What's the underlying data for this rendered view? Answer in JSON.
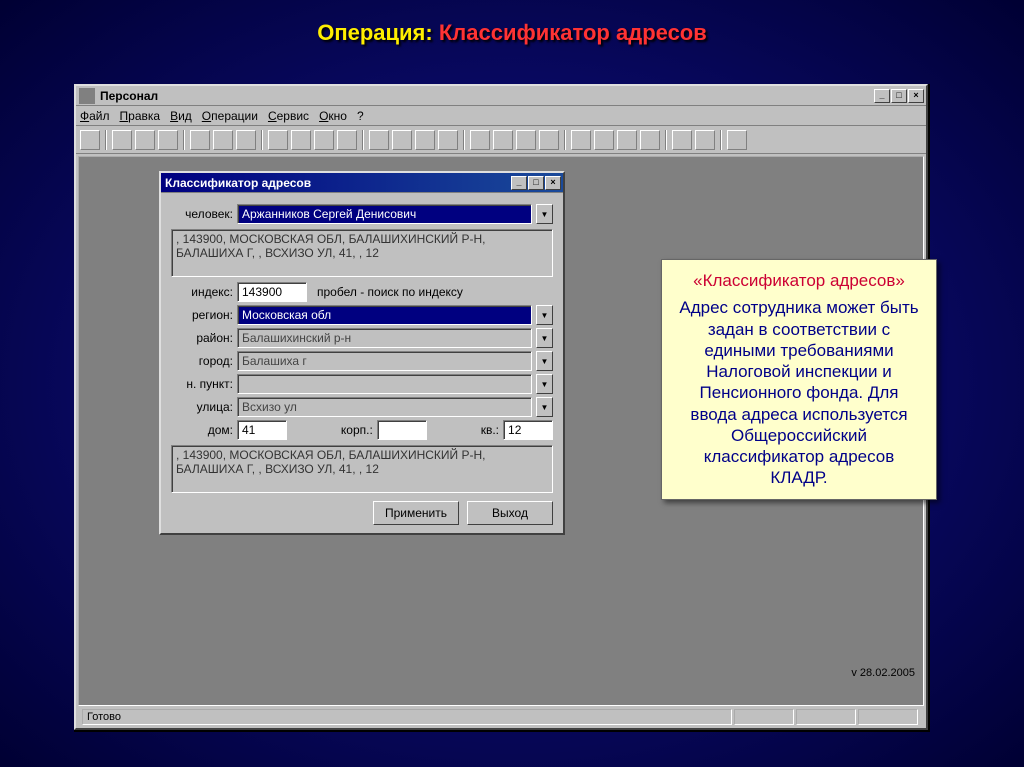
{
  "slide": {
    "title_label": "Операция:",
    "title_value": "Классификатор адресов"
  },
  "outer_window": {
    "title": "Персонал",
    "menu": {
      "file": "Файл",
      "edit": "Правка",
      "view": "Вид",
      "ops": "Операции",
      "service": "Сервис",
      "window": "Окно",
      "help": "?"
    },
    "status": "Готово",
    "version": "v 28.02.2005"
  },
  "callout": {
    "title": "«Классификатор адресов»",
    "body": "Адрес сотрудника может быть задан в соответствии с едиными требованиями Налоговой инспекции и Пенсионного фонда. Для ввода адреса используется Общероссийский классификатор адресов КЛАДР."
  },
  "dialog": {
    "title": "Классификатор адресов",
    "person_label": "человек:",
    "person_value": "Аржанников Сергей Денисович",
    "address_preview": ", 143900, МОСКОВСКАЯ ОБЛ, БАЛАШИХИНСКИЙ Р-Н, БАЛАШИХА Г, , ВСХИЗО УЛ, 41, , 12",
    "index_label": "индекс:",
    "index_value": "143900",
    "index_hint": "пробел - поиск по индексу",
    "region_label": "регион:",
    "region_value": "Московская обл",
    "rayon_label": "район:",
    "rayon_value": "Балашихинский р-н",
    "gorod_label": "город:",
    "gorod_value": "Балашиха г",
    "npunkt_label": "н. пункт:",
    "npunkt_value": "",
    "ulitsa_label": "улица:",
    "ulitsa_value": "Всхизо ул",
    "dom_label": "дом:",
    "dom_value": "41",
    "korp_label": "корп.:",
    "korp_value": "",
    "kv_label": "кв.:",
    "kv_value": "12",
    "apply_btn": "Применить",
    "exit_btn": "Выход"
  }
}
